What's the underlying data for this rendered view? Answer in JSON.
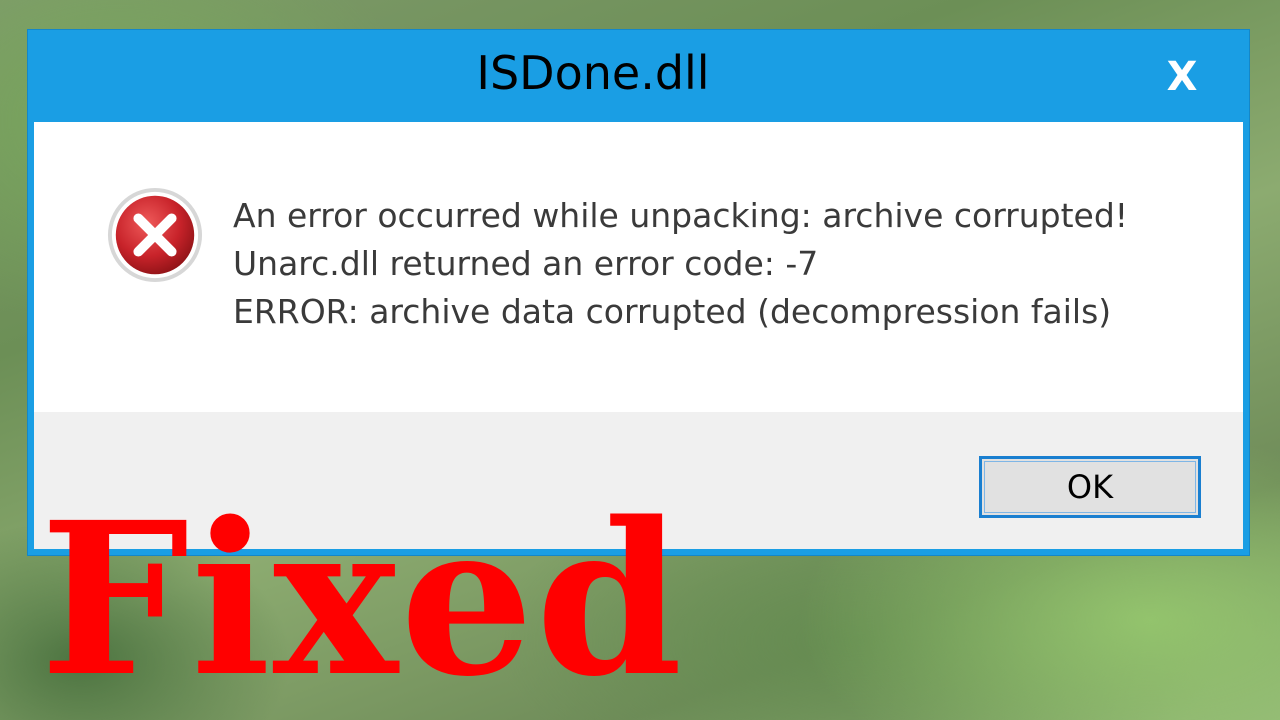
{
  "dialog": {
    "title": "ISDone.dll",
    "close_label": "X",
    "icon": "error-icon",
    "messages": [
      "An error occurred while unpacking: archive corrupted!",
      "Unarc.dll returned an error code: -7",
      "ERROR: archive data corrupted (decompression fails)"
    ],
    "ok_label": "OK"
  },
  "overlay": {
    "caption": "Fixed"
  },
  "colors": {
    "titlebar": "#1a9ee4",
    "caption": "#ff0000",
    "error_icon": "#c8232a",
    "button_border": "#1a7fd0"
  }
}
